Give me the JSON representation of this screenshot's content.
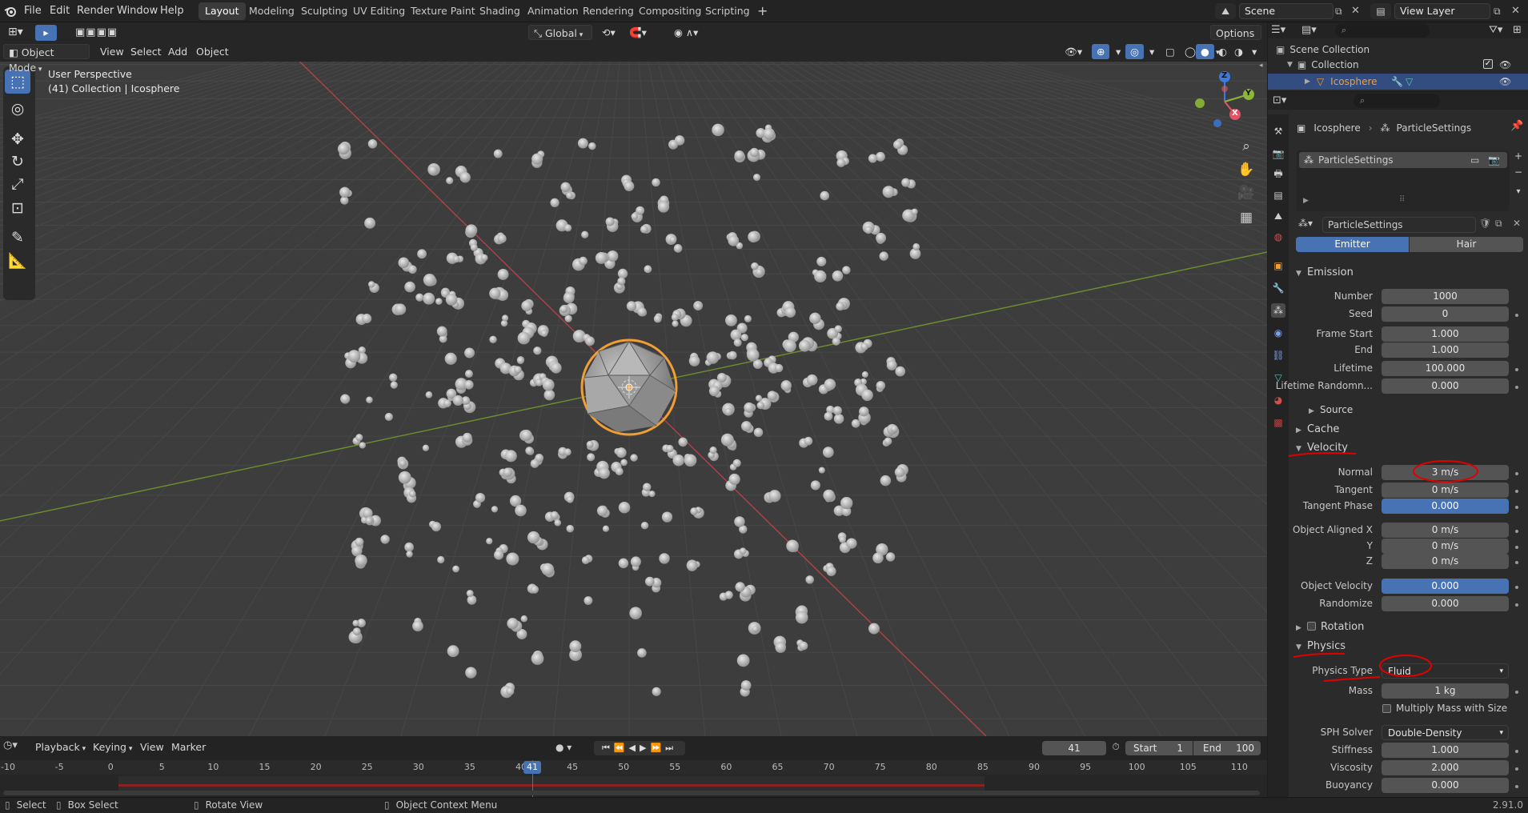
{
  "app": {
    "menus": [
      "File",
      "Edit",
      "Render",
      "Window",
      "Help"
    ],
    "workspaces": [
      "Layout",
      "Modeling",
      "Sculpting",
      "UV Editing",
      "Texture Paint",
      "Shading",
      "Animation",
      "Rendering",
      "Compositing",
      "Scripting"
    ],
    "active_workspace": "Layout",
    "add_workspace": "+",
    "scene": "Scene",
    "view_layer": "View Layer"
  },
  "viewport_header": {
    "mode": "Object Mode",
    "menus": [
      "View",
      "Select",
      "Add",
      "Object"
    ],
    "orientation": "Global",
    "options": "Options"
  },
  "viewport": {
    "perspective": "User Perspective",
    "collection_info": "(41) Collection | Icosphere",
    "gizmo": {
      "x": "X",
      "y": "Y",
      "z": "Z"
    }
  },
  "outliner": {
    "scene_collection": "Scene Collection",
    "collection": "Collection",
    "object": "Icosphere"
  },
  "properties": {
    "breadcrumb_object": "Icosphere",
    "breadcrumb_settings": "ParticleSettings",
    "slot_name": "ParticleSettings",
    "datablock_name": "ParticleSettings",
    "emitter_label": "Emitter",
    "hair_label": "Hair",
    "emission": {
      "title": "Emission",
      "number_label": "Number",
      "number": "1000",
      "seed_label": "Seed",
      "seed": "0",
      "frame_start_label": "Frame Start",
      "frame_start": "1.000",
      "end_label": "End",
      "end": "1.000",
      "lifetime_label": "Lifetime",
      "lifetime": "100.000",
      "lifetime_random_label": "Lifetime Randomn...",
      "lifetime_random": "0.000",
      "source_label": "Source"
    },
    "cache_title": "Cache",
    "velocity": {
      "title": "Velocity",
      "normal_label": "Normal",
      "normal": "3 m/s",
      "tangent_label": "Tangent",
      "tangent": "0 m/s",
      "tangent_phase_label": "Tangent Phase",
      "tangent_phase": "0.000",
      "obj_aligned_x_label": "Object Aligned X",
      "obj_aligned_x": "0 m/s",
      "y_label": "Y",
      "y": "0 m/s",
      "z_label": "Z",
      "z": "0 m/s",
      "object_velocity_label": "Object Velocity",
      "object_velocity": "0.000",
      "randomize_label": "Randomize",
      "randomize": "0.000"
    },
    "rotation_title": "Rotation",
    "physics": {
      "title": "Physics",
      "type_label": "Physics Type",
      "type": "Fluid",
      "mass_label": "Mass",
      "mass": "1 kg",
      "multiply_mass_label": "Multiply Mass with Size",
      "sph_solver_label": "SPH Solver",
      "sph_solver": "Double-Density",
      "stiffness_label": "Stiffness",
      "stiffness": "1.000",
      "viscosity_label": "Viscosity",
      "viscosity": "2.000",
      "buoyancy_label": "Buoyancy",
      "buoyancy": "0.000"
    }
  },
  "timeline": {
    "menus": [
      "Playback",
      "Keying",
      "View",
      "Marker"
    ],
    "current_frame": "41",
    "start_label": "Start",
    "start": "1",
    "end_label": "End",
    "end": "100",
    "ruler": [
      "-10",
      "-5",
      "0",
      "5",
      "10",
      "15",
      "20",
      "25",
      "30",
      "35",
      "40",
      "45",
      "50",
      "55",
      "60",
      "65",
      "70",
      "75",
      "80",
      "85",
      "90",
      "95",
      "100",
      "105",
      "110"
    ],
    "playhead": "41"
  },
  "statusbar": {
    "select": "Select",
    "box_select": "Box Select",
    "rotate_view": "Rotate View",
    "context_menu": "Object Context Menu",
    "version": "2.91.0"
  },
  "colors": {
    "accent": "#4772b3",
    "selected_outline": "#f19e35",
    "annotation": "#e00000",
    "x_axis": "#cf4048",
    "y_axis": "#7ea52b"
  }
}
